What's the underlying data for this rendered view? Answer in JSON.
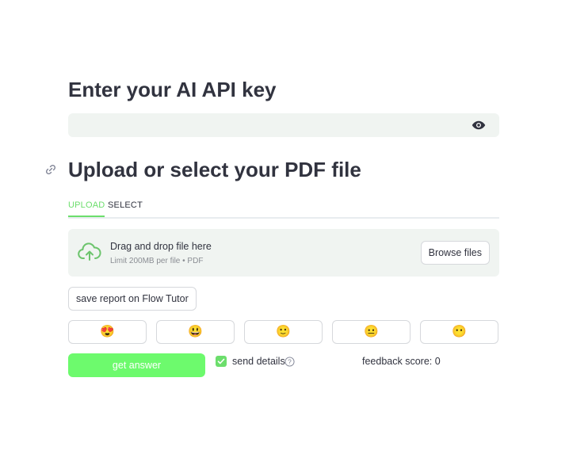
{
  "api_section": {
    "title": "Enter your AI API key",
    "input_value": "",
    "input_placeholder": ""
  },
  "pdf_section": {
    "title": "Upload or select your PDF file",
    "tabs": [
      {
        "label": "UPLOAD",
        "active": true
      },
      {
        "label": "SELECT",
        "active": false
      }
    ],
    "uploader": {
      "title": "Drag and drop file here",
      "limit": "Limit 200MB per file • PDF",
      "browse_label": "Browse files"
    }
  },
  "save_report_label": "save report on Flow Tutor",
  "feedback_faces": [
    "😍",
    "😃",
    "🙂",
    "😐",
    "😶"
  ],
  "get_answer_label": "get answer",
  "send_details": {
    "label": "send details",
    "checked": true
  },
  "feedback_score": "feedback score: 0",
  "colors": {
    "accent": "#6cde6c",
    "button_primary": "#6dfa6d",
    "input_bg": "#f0f4f1",
    "text": "#31333f"
  }
}
